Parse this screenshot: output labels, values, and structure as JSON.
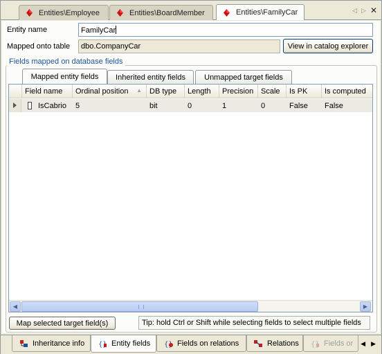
{
  "doc_tabs": [
    {
      "label": "Entities\\Employee",
      "active": false
    },
    {
      "label": "Entities\\BoardMember",
      "active": false
    },
    {
      "label": "Entities\\FamilyCar",
      "active": true
    }
  ],
  "doc_tab_controls": {
    "prev": "◁",
    "next": "▷",
    "close": "✕"
  },
  "form": {
    "entity_name_label": "Entity name",
    "entity_name_value": "FamilyCar",
    "mapped_table_label": "Mapped onto table",
    "mapped_table_value": "dbo.CompanyCar",
    "view_catalog_button": "View in catalog explorer"
  },
  "group_title": "Fields mapped on database fields",
  "inner_tabs": [
    {
      "label": "Mapped entity fields",
      "active": true
    },
    {
      "label": "Inherited entity fields",
      "active": false
    },
    {
      "label": "Unmapped target fields",
      "active": false
    }
  ],
  "grid": {
    "columns": [
      "Field name",
      "Ordinal position",
      "DB type",
      "Length",
      "Precision",
      "Scale",
      "Is PK",
      "Is computed"
    ],
    "sort_indicator": "▲",
    "rows": [
      {
        "field_name": "IsCabrio",
        "ordinal_position": "5",
        "db_type": "bit",
        "length": "0",
        "precision": "1",
        "scale": "0",
        "is_pk": "False",
        "is_computed": "False"
      }
    ]
  },
  "scroll": {
    "left": "◀",
    "right": "▶"
  },
  "map_button": "Map selected target field(s)",
  "tip": "Tip: hold Ctrl or Shift while selecting fields to select multiple fields",
  "bottom_tabs": [
    {
      "label": "Inheritance info",
      "active": false,
      "icon": "inheritance-icon"
    },
    {
      "label": "Entity fields",
      "active": true,
      "icon": "entity-fields-icon"
    },
    {
      "label": "Fields on relations",
      "active": false,
      "icon": "fields-on-relations-icon"
    },
    {
      "label": "Relations",
      "active": false,
      "icon": "relations-icon"
    },
    {
      "label": "Fields or",
      "active": false,
      "icon": "fields-icon"
    }
  ],
  "bottom_nav": {
    "prev": "◀",
    "next": "▶"
  },
  "colors": {
    "accent_blue": "#1c5597",
    "gem_red": "#d01010",
    "icon_blue": "#2050a0",
    "icon_red": "#c02020"
  }
}
